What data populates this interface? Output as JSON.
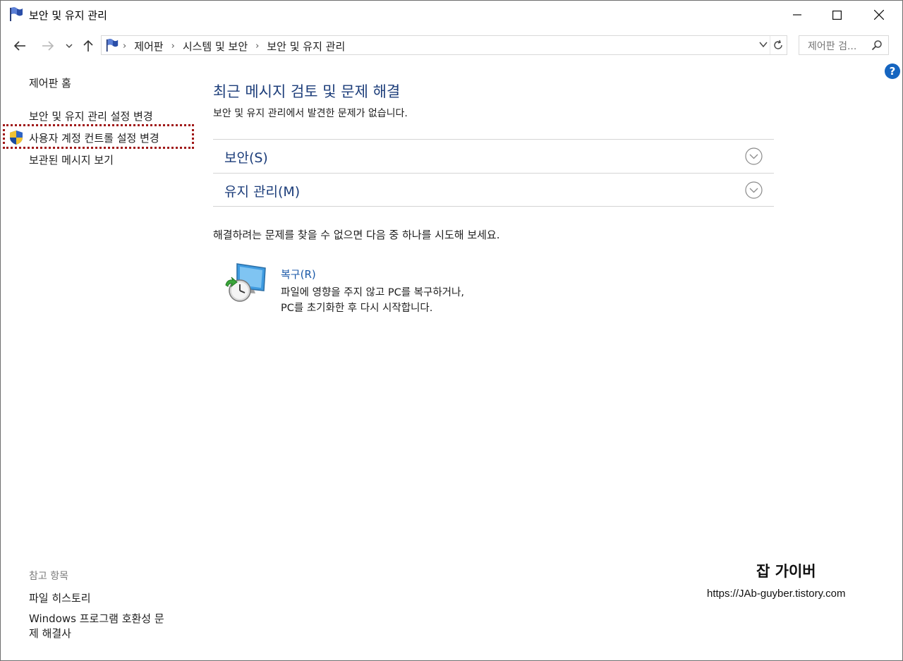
{
  "window": {
    "title": "보안 및 유지 관리"
  },
  "address": {
    "breadcrumbs": [
      "제어판",
      "시스템 및 보안",
      "보안 및 유지 관리"
    ],
    "search_placeholder": "제어판 검..."
  },
  "left_pane": {
    "home_link": "제어판 홈",
    "change_settings_link": "보안 및 유지 관리 설정 변경",
    "uac_link": "사용자 계정 컨트롤 설정 변경",
    "archived_link": "보관된 메시지 보기",
    "see_also_heading": "참고 항목",
    "file_history_link": "파일 히스토리",
    "compat_link": "Windows 프로그램 호환성 문제 해결사"
  },
  "main": {
    "heading": "최근 메시지 검토 및 문제 해결",
    "subtitle": "보안 및 유지 관리에서 발견한 문제가 없습니다.",
    "sections": [
      {
        "label": "보안(S)"
      },
      {
        "label": "유지 관리(M)"
      }
    ],
    "try_text": "해결하려는 문제를 찾을 수 없으면 다음 중 하나를 시도해 보세요.",
    "recovery": {
      "link": "복구(R)",
      "description": "파일에 영향을 주지 않고 PC를 복구하거나, PC를 초기화한 후 다시 시작합니다."
    }
  },
  "watermark": {
    "title": "잡 가이버",
    "url": "https://JAb-guyber.tistory.com"
  },
  "colors": {
    "link_blue": "#1c3d7a",
    "highlight_red": "#a01818",
    "help_blue": "#1565c0"
  },
  "icons": [
    "flag-icon",
    "back-icon",
    "forward-icon",
    "recent-dropdown-icon",
    "up-icon",
    "dropdown-icon",
    "refresh-icon",
    "search-icon",
    "help-icon",
    "uac-shield-icon",
    "chevron-down-circle-icon",
    "recovery-icon",
    "minimize-icon",
    "maximize-icon",
    "close-icon"
  ]
}
